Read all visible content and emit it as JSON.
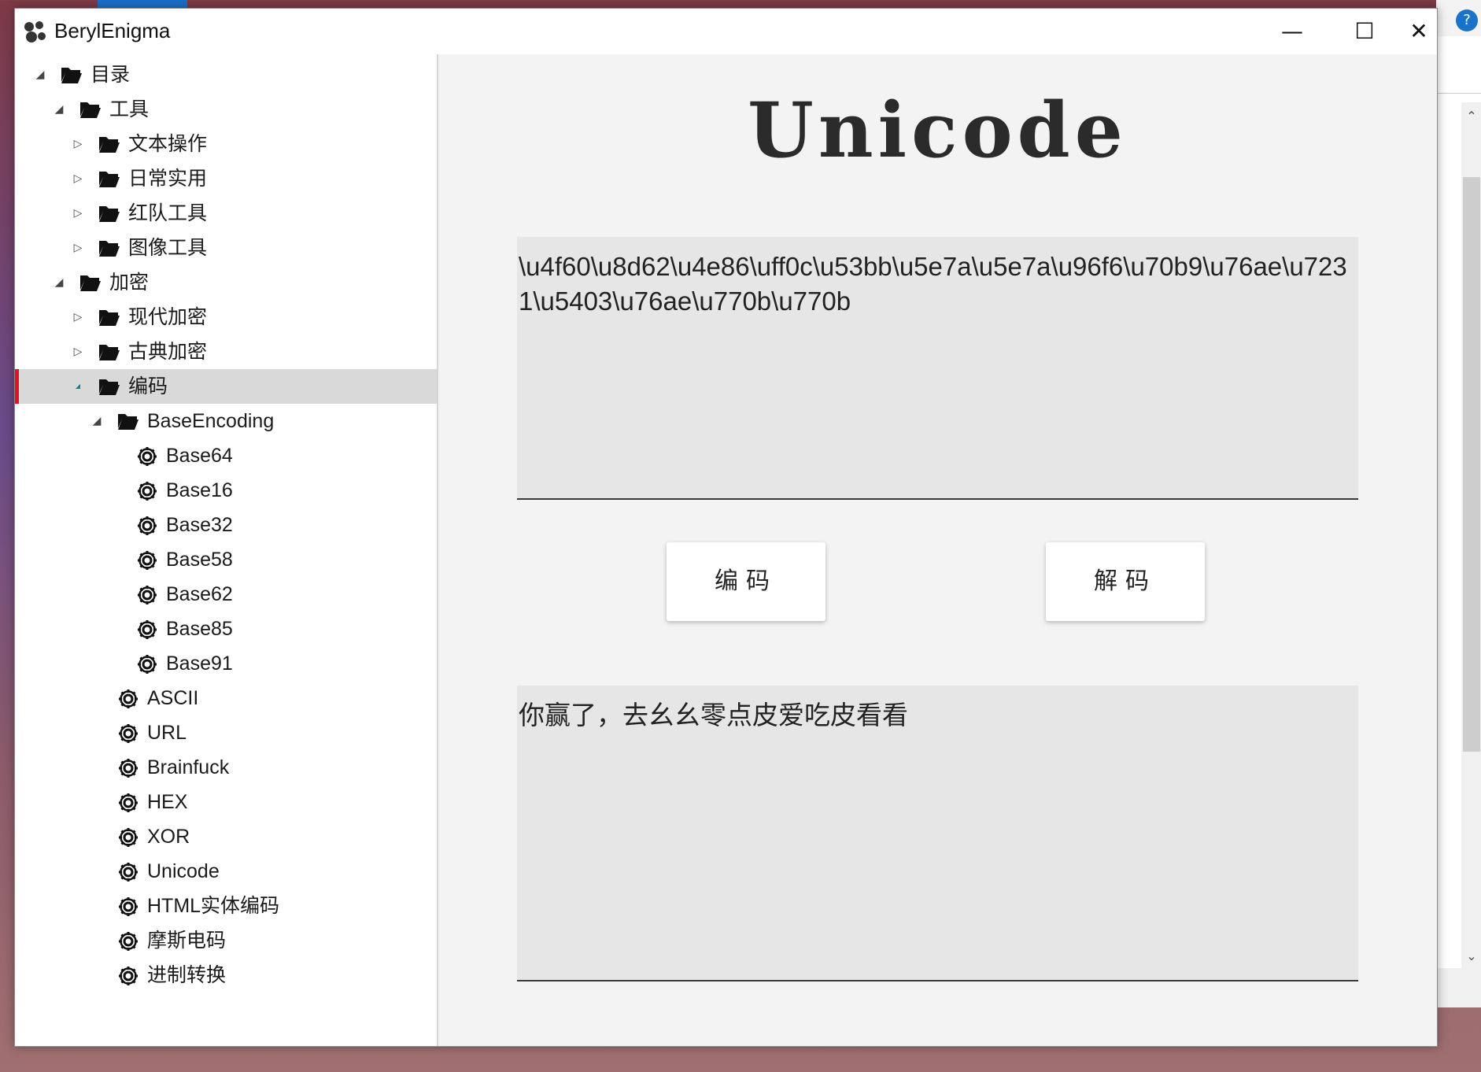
{
  "window": {
    "title": "BerylEnigma",
    "minimize_glyph": "—",
    "maximize_glyph": "☐",
    "close_glyph": "✕"
  },
  "tree": [
    {
      "label": "目录",
      "icon": "folder-open-icon",
      "level": 0,
      "expander": "expanded"
    },
    {
      "label": "工具",
      "icon": "folder-open-icon",
      "level": 1,
      "expander": "expanded"
    },
    {
      "label": "文本操作",
      "icon": "folder-open-icon",
      "level": 2,
      "expander": "collapsed"
    },
    {
      "label": "日常实用",
      "icon": "folder-open-icon",
      "level": 2,
      "expander": "collapsed"
    },
    {
      "label": "红队工具",
      "icon": "folder-open-icon",
      "level": 2,
      "expander": "collapsed"
    },
    {
      "label": "图像工具",
      "icon": "folder-open-icon",
      "level": 2,
      "expander": "collapsed"
    },
    {
      "label": "加密",
      "icon": "folder-open-icon",
      "level": 1,
      "expander": "expanded"
    },
    {
      "label": "现代加密",
      "icon": "folder-open-icon",
      "level": 2,
      "expander": "collapsed"
    },
    {
      "label": "古典加密",
      "icon": "folder-open-icon",
      "level": 2,
      "expander": "collapsed"
    },
    {
      "label": "编码",
      "icon": "folder-open-icon",
      "level": 2,
      "expander": "expanded-small",
      "selected": true
    },
    {
      "label": "BaseEncoding",
      "icon": "folder-open-icon",
      "level": 3,
      "expander": "expanded"
    },
    {
      "label": "Base64",
      "icon": "gear-icon",
      "level": 4
    },
    {
      "label": "Base16",
      "icon": "gear-icon",
      "level": 4
    },
    {
      "label": "Base32",
      "icon": "gear-icon",
      "level": 4
    },
    {
      "label": "Base58",
      "icon": "gear-icon",
      "level": 4
    },
    {
      "label": "Base62",
      "icon": "gear-icon",
      "level": 4
    },
    {
      "label": "Base85",
      "icon": "gear-icon",
      "level": 4
    },
    {
      "label": "Base91",
      "icon": "gear-icon",
      "level": 4
    },
    {
      "label": "ASCII",
      "icon": "gear-icon",
      "level": 3
    },
    {
      "label": "URL",
      "icon": "gear-icon",
      "level": 3
    },
    {
      "label": "Brainfuck",
      "icon": "gear-icon",
      "level": 3
    },
    {
      "label": "HEX",
      "icon": "gear-icon",
      "level": 3
    },
    {
      "label": "XOR",
      "icon": "gear-icon",
      "level": 3
    },
    {
      "label": "Unicode",
      "icon": "gear-icon",
      "level": 3
    },
    {
      "label": "HTML实体编码",
      "icon": "gear-icon",
      "level": 3
    },
    {
      "label": "摩斯电码",
      "icon": "gear-icon",
      "level": 3
    },
    {
      "label": "进制转换",
      "icon": "gear-icon",
      "level": 3
    }
  ],
  "main": {
    "heading": "Unicode",
    "input_text": "\\u4f60\\u8d62\\u4e86\\uff0c\\u53bb\\u5e7a\\u5e7a\\u96f6\\u70b9\\u76ae\\u7231\\u5403\\u76ae\\u770b\\u770b",
    "encode_button": "编码",
    "decode_button": "解码",
    "output_text": "你赢了，去幺幺零点皮爱吃皮看看"
  },
  "colors": {
    "selection_bg": "#d9d9d9",
    "selection_marker": "#e81123",
    "pane_bg": "#f3f3f3",
    "textbox_bg": "#e6e6e6"
  },
  "background_app": {
    "help_glyph": "?"
  }
}
